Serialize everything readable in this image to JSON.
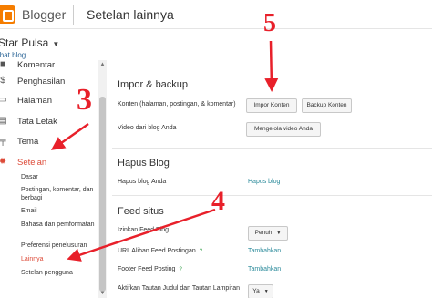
{
  "header": {
    "brand": "Blogger",
    "page_title": "Setelan lainnya"
  },
  "blog": {
    "name": "Star Pulsa",
    "view_link": "ihat blog"
  },
  "sidebar": {
    "items": [
      {
        "icon": "comment-icon",
        "label": "Komentar"
      },
      {
        "icon": "dollar-icon",
        "label": "Penghasilan"
      },
      {
        "icon": "page-icon",
        "label": "Halaman"
      },
      {
        "icon": "layout-icon",
        "label": "Tata Letak"
      },
      {
        "icon": "paint-roller-icon",
        "label": "Tema"
      },
      {
        "icon": "gear-icon",
        "label": "Setelan"
      }
    ],
    "sub_items": [
      "Dasar",
      "Postingan, komentar, dan berbagi",
      "Email",
      "Bahasa dan pemformatan",
      "Preferensi penelusuran",
      "Lainnya",
      "Setelan pengguna"
    ]
  },
  "main": {
    "import_backup": {
      "title": "Impor & backup",
      "content_label": "Konten (halaman, postingan, & komentar)",
      "import_button": "Impor Konten",
      "backup_button": "Backup Konten",
      "video_label": "Video dari blog Anda",
      "video_button": "Mengelola video Anda"
    },
    "delete_blog": {
      "title": "Hapus Blog",
      "label": "Hapus blog Anda",
      "link": "Hapus blog"
    },
    "feed": {
      "title": "Feed situs",
      "allow_label": "Izinkan Feed Blog",
      "allow_value": "Penuh",
      "redirect_label": "URL Alihan Feed Postingan",
      "redirect_link": "Tambahkan",
      "footer_label": "Footer Feed Posting",
      "footer_link": "Tambahkan",
      "enable_label": "Aktifkan Tautan Judul dan Tautan Lampiran",
      "enable_value": "Ya",
      "help": "?"
    }
  },
  "annotations": {
    "step3": "3",
    "step4": "4",
    "step5": "5",
    "color": "#e8202a"
  }
}
